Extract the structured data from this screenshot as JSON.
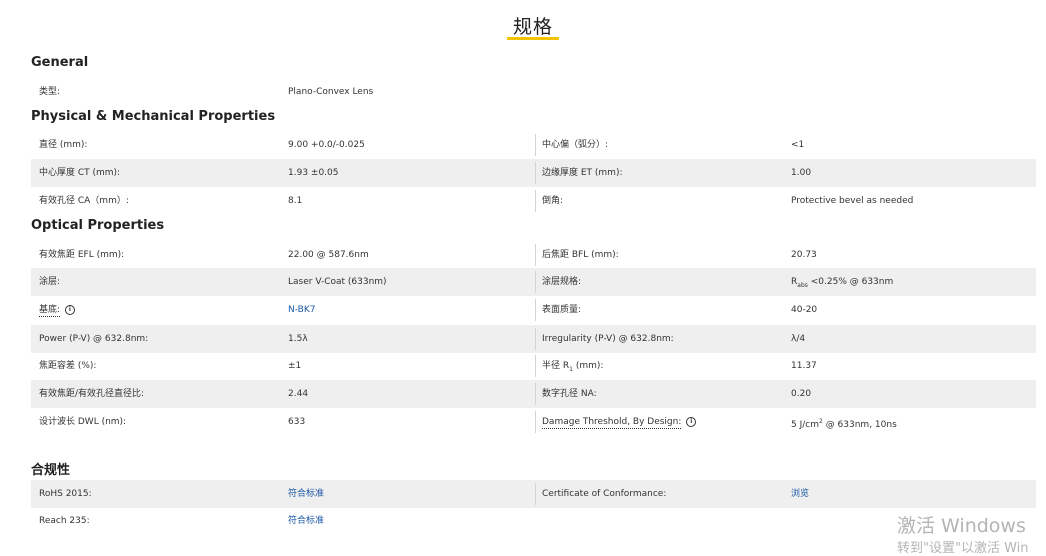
{
  "page_title": "规格",
  "sections": {
    "general": "General",
    "physical": "Physical & Mechanical Properties",
    "optical": "Optical Properties",
    "compliance": "合规性"
  },
  "general": {
    "type_label": "类型:",
    "type_value": "Plano-Convex Lens"
  },
  "physical": {
    "diameter_label": "直径 (mm):",
    "diameter_value": "9.00 +0.0/-0.025",
    "centering_label": "中心偏（弧分）:",
    "centering_value": "<1",
    "ct_label": "中心厚度 CT (mm):",
    "ct_value": "1.93 ±0.05",
    "et_label": "边缘厚度 ET (mm):",
    "et_value": "1.00",
    "ca_label": "有效孔径 CA（mm）:",
    "ca_value": "8.1",
    "bevel_label": "倒角:",
    "bevel_value": "Protective bevel as needed"
  },
  "optical": {
    "efl_label": "有效焦距 EFL (mm):",
    "efl_value": "22.00 @ 587.6nm",
    "bfl_label": "后焦距 BFL (mm):",
    "bfl_value": "20.73",
    "coating_label": "涂层:",
    "coating_value": "Laser V-Coat (633nm)",
    "coating_spec_label": "涂层规格:",
    "coating_spec_r": "R",
    "coating_spec_sub": "abs",
    "coating_spec_rest": " <0.25% @ 633nm",
    "substrate_label": "基底:",
    "substrate_value": "N-BK7",
    "surface_label": "表面质量:",
    "surface_value": "40-20",
    "power_label": "Power (P-V) @ 632.8nm:",
    "power_value": "1.5λ",
    "irregularity_label": "Irregularity (P-V) @ 632.8nm:",
    "irregularity_value": "λ/4",
    "fl_tol_label": "焦距容差 (%):",
    "fl_tol_value": "±1",
    "radius_label_pre": "半径 R",
    "radius_label_sub": "1",
    "radius_label_post": " (mm):",
    "radius_value": "11.37",
    "fnum_label": "有效焦距/有效孔径直径比:",
    "fnum_value": "2.44",
    "na_label": "数字孔径 NA:",
    "na_value": "0.20",
    "dwl_label": "设计波长 DWL (nm):",
    "dwl_value": "633",
    "damage_label": "Damage Threshold, By Design:",
    "damage_value_pre": "5 J/cm",
    "damage_value_sup": "2",
    "damage_value_post": " @ 633nm, 10ns"
  },
  "compliance": {
    "rohs_label": "RoHS 2015:",
    "rohs_value": "符合标准",
    "coc_label": "Certificate of Conformance:",
    "coc_value": "浏览",
    "reach_label": "Reach 235:",
    "reach_value": "符合标准"
  },
  "info_icon_glyph": "i",
  "watermark": {
    "line1": "激活 Windows",
    "line2": "转到\"设置\"以激活 Win"
  }
}
